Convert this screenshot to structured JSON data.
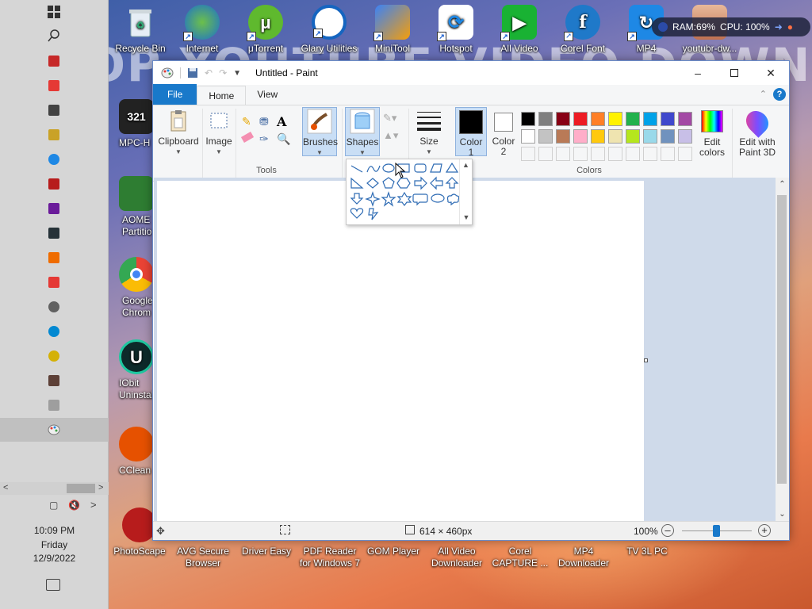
{
  "taskbar": {
    "clock_time": "10:09 PM",
    "clock_day": "Friday",
    "clock_date": "12/9/2022"
  },
  "desktop": {
    "background_text": "TOP YOUTUBE VIDEO DOWNLOADER",
    "icons_top": [
      "Recycle Bin",
      "Internet",
      "μTorrent",
      "Glary Utilities",
      "MiniTool",
      "Hotspot",
      "All Video",
      "Corel Font",
      "MP4",
      "youtubr-dw..."
    ],
    "icons_left": [
      "MPC-H",
      "AOME Partitio",
      "Google Chrom",
      "IObit Uninstal",
      "CClean",
      "PhotoScape"
    ],
    "icons_bottom": [
      {
        "l1": "AVG Secure",
        "l2": "Browser"
      },
      {
        "l1": "Driver Easy",
        "l2": ""
      },
      {
        "l1": "PDF Reader",
        "l2": "for Windows 7"
      },
      {
        "l1": "GOM Player",
        "l2": ""
      },
      {
        "l1": "All Video",
        "l2": "Downloader"
      },
      {
        "l1": "Corel",
        "l2": "CAPTURE ..."
      },
      {
        "l1": "MP4",
        "l2": "Downloader"
      },
      {
        "l1": "TV 3L PC",
        "l2": ""
      }
    ],
    "perf_widget": {
      "ram": "RAM:69%",
      "cpu": "CPU: 100%"
    }
  },
  "paint": {
    "title": "Untitled - Paint",
    "tabs": {
      "file": "File",
      "home": "Home",
      "view": "View"
    },
    "ribbon": {
      "clipboard": "Clipboard",
      "image": "Image",
      "tools": "Tools",
      "brushes": "Brushes",
      "shapes": "Shapes",
      "size": "Size",
      "color1_l1": "Color",
      "color1_l2": "1",
      "color2_l1": "Color",
      "color2_l2": "2",
      "edit_colors_l1": "Edit",
      "edit_colors_l2": "colors",
      "edit_paint3d_l1": "Edit with",
      "edit_paint3d_l2": "Paint 3D",
      "colors": "Colors"
    },
    "palette_row1": [
      "#000000",
      "#7f7f7f",
      "#880015",
      "#ed1c24",
      "#ff7f27",
      "#fff200",
      "#22b14c",
      "#00a2e8",
      "#3f48cc",
      "#a349a4"
    ],
    "palette_row2": [
      "#ffffff",
      "#c3c3c3",
      "#b97a57",
      "#ffaec9",
      "#ffc90e",
      "#efe4b0",
      "#b5e61d",
      "#99d9ea",
      "#7092be",
      "#c8bfe7"
    ],
    "status": {
      "image_size": "614 × 460px",
      "zoom": "100%"
    }
  }
}
